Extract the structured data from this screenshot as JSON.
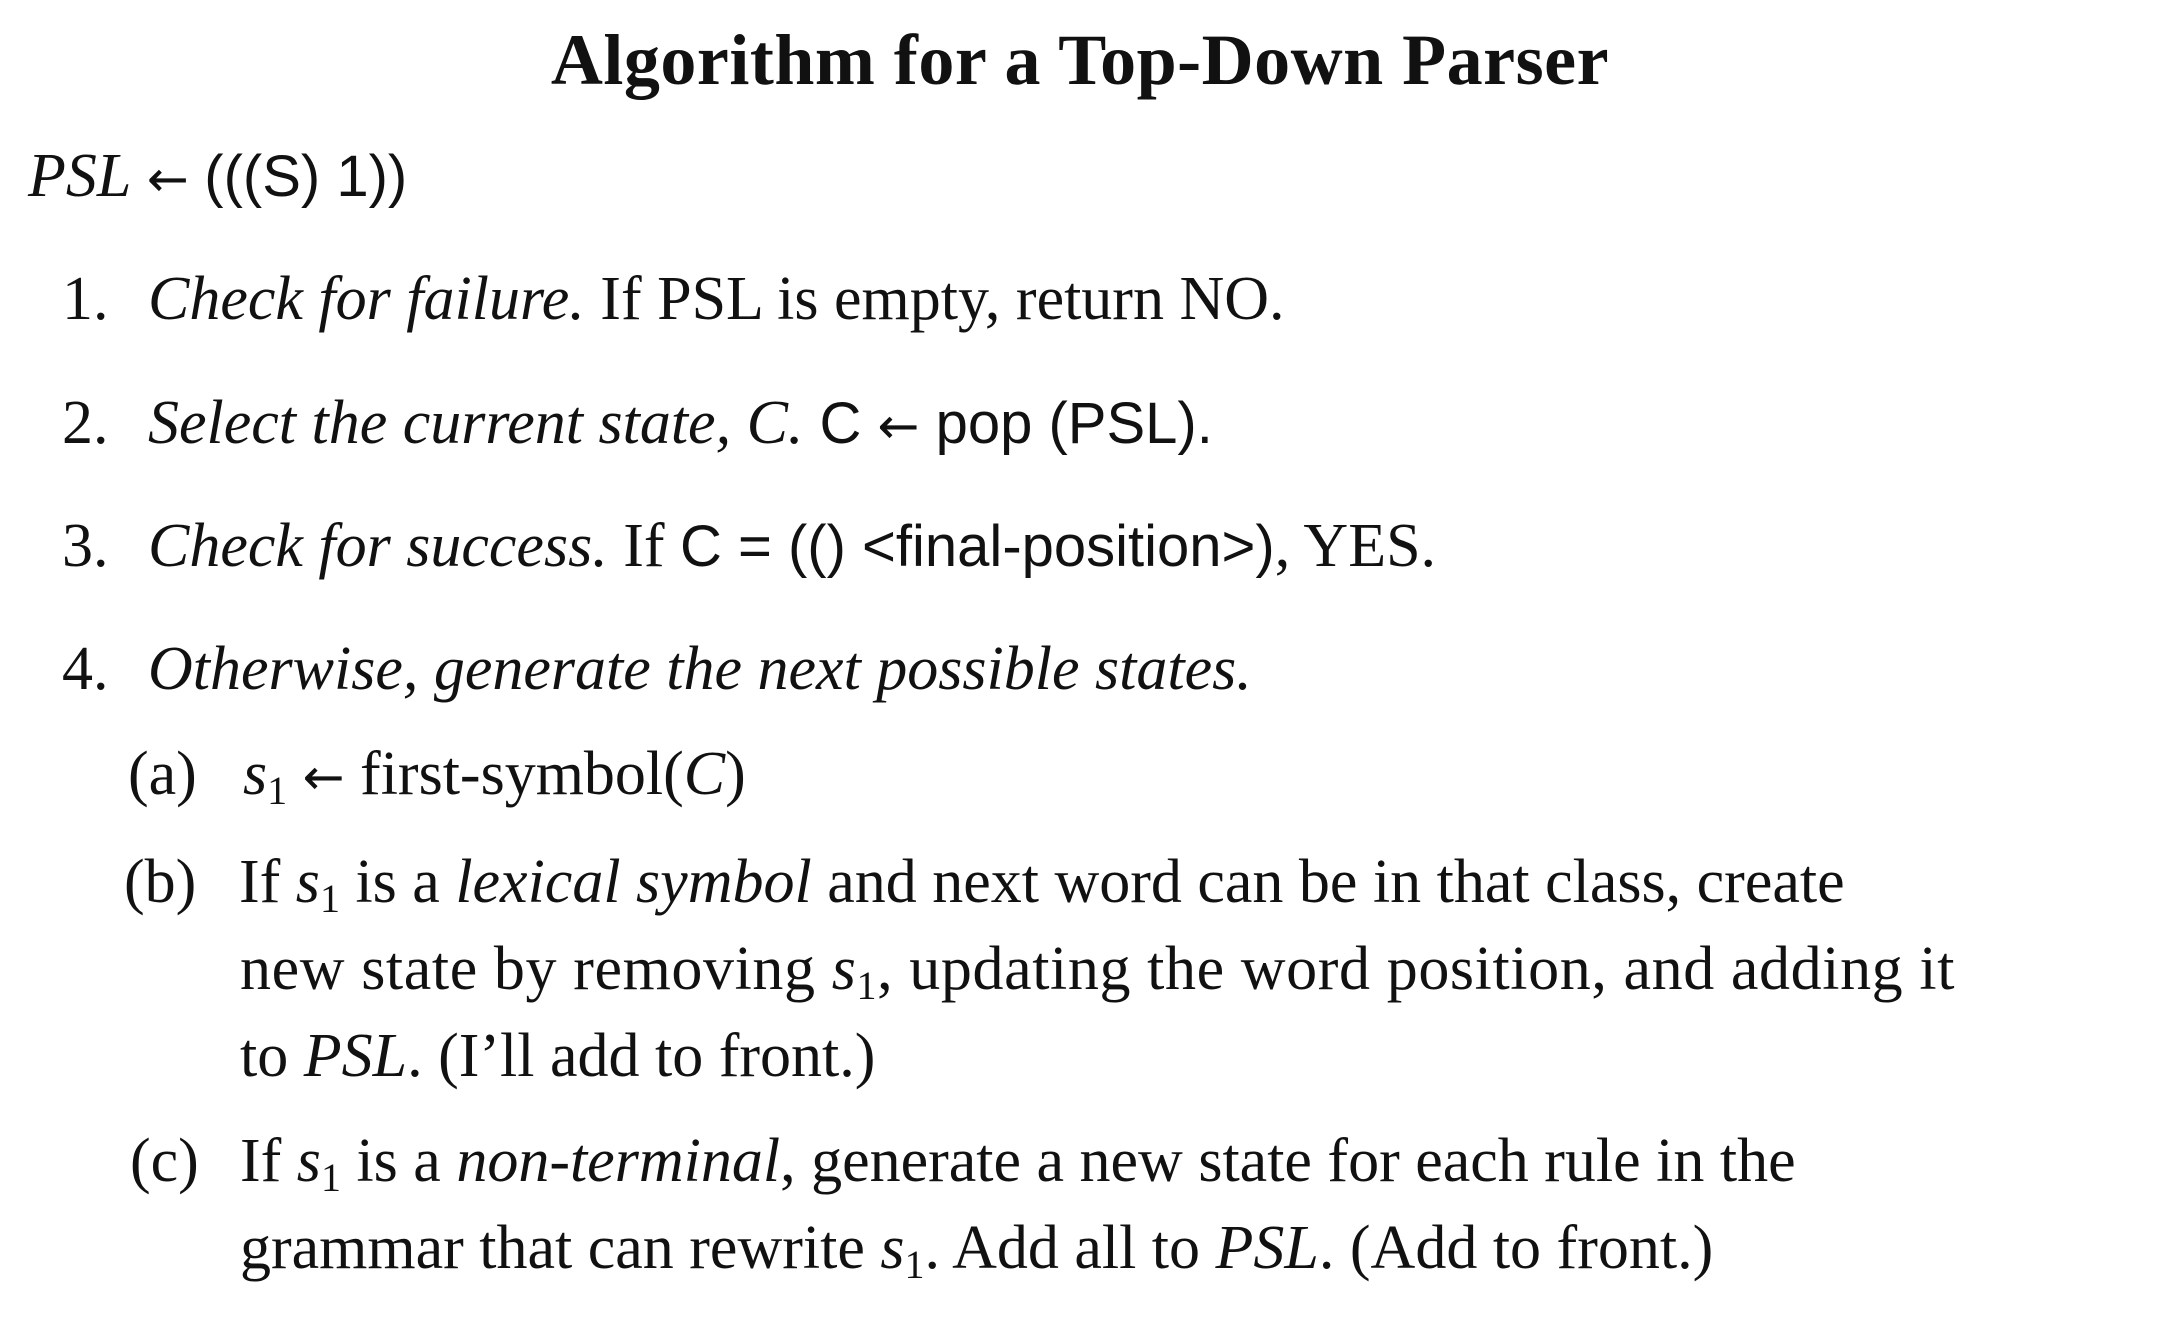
{
  "title": "Algorithm for a Top-Down Parser",
  "init": {
    "var": "PSL",
    "arrow": "←",
    "value": "(((S) 1))"
  },
  "steps": [
    {
      "num": "1.",
      "lead": "Check for failure.",
      "text": " If PSL is empty, return NO."
    },
    {
      "num": "2.",
      "lead": "Select the current state, C.",
      "code_var": " C ",
      "arrow": "←",
      "code_val": " pop (PSL)."
    },
    {
      "num": "3.",
      "lead": "Check for success.",
      "pre": " If ",
      "code_expr": "C = (() <final-position>)",
      "post": ", YES."
    },
    {
      "num": "4.",
      "lead": "Otherwise, generate the next possible states."
    }
  ],
  "substeps": {
    "a": {
      "label": "(a)",
      "var": "s",
      "sub": "1",
      "arrow": "←",
      "text": " first-symbol(",
      "arg": "C",
      "close": ")"
    },
    "b": {
      "label": "(b)",
      "t1": "If ",
      "var": "s",
      "sub": "1",
      "t2": " is a ",
      "em": "lexical symbol",
      "t3": " and next word can be in that class, create",
      "line2a": "new state by removing ",
      "line2var": "s",
      "line2sub": "1",
      "line2b": ", updating the word position, and adding it",
      "line3a": "to ",
      "line3em": "PSL",
      "line3b": ". (I’ll add to front.)"
    },
    "c": {
      "label": "(c)",
      "t1": "If ",
      "var": "s",
      "sub": "1",
      "t2": " is a ",
      "em": "non-terminal",
      "t3": ", generate a new state for each rule in the",
      "line2a": "grammar that can rewrite ",
      "line2var": "s",
      "line2sub": "1",
      "line2b": ". Add all to ",
      "line2em": "PSL",
      "line2c": ". (Add to front.)"
    }
  }
}
